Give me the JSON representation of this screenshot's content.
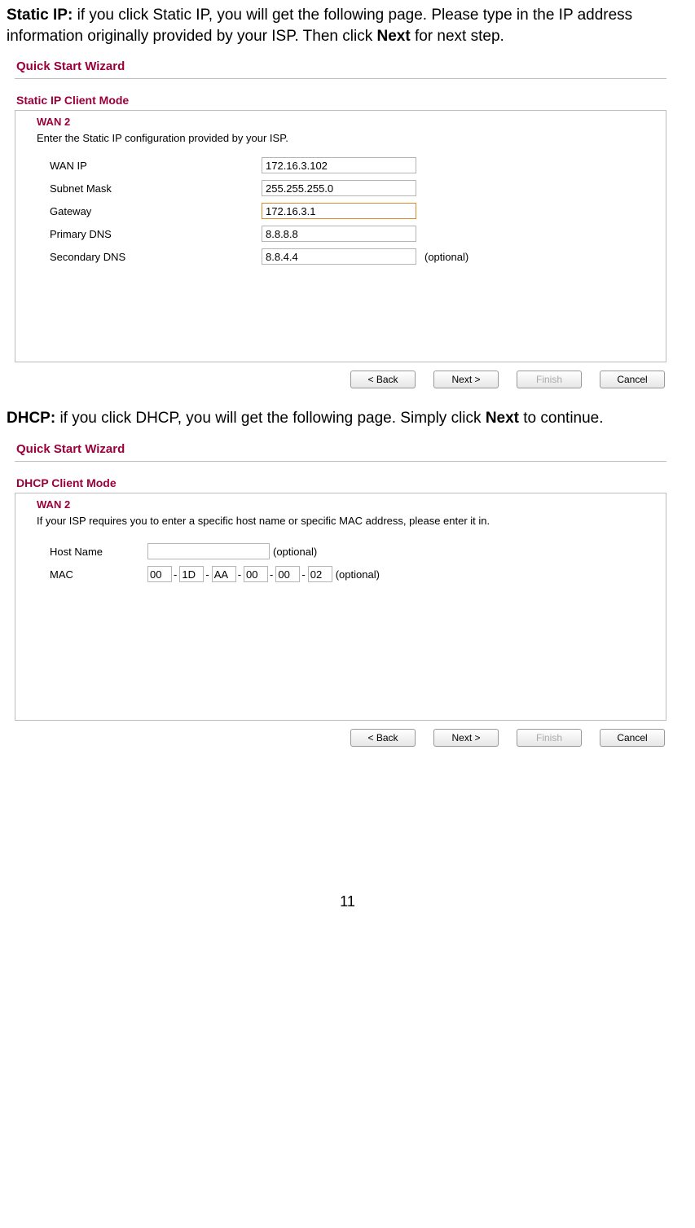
{
  "para1": {
    "lead": "Static IP:",
    "text": " if you click Static IP, you will get the following page. Please type in the IP address information originally provided by your ISP. Then click ",
    "bold_end": "Next",
    "tail": " for next step."
  },
  "para2": {
    "lead": "DHCP:",
    "text": " if you click DHCP, you will get the following page. Simply click ",
    "bold_end": "Next",
    "tail": " to continue."
  },
  "wizard": {
    "title": "Quick Start Wizard",
    "static_mode": "Static IP Client Mode",
    "dhcp_mode": "DHCP Client Mode",
    "wan_heading": "WAN 2",
    "static_desc": "Enter the Static IP configuration provided by your ISP.",
    "dhcp_desc": "If your ISP requires you to enter a specific host name or specific MAC address, please enter it in.",
    "labels": {
      "wan_ip": "WAN IP",
      "subnet": "Subnet Mask",
      "gateway": "Gateway",
      "pdns": "Primary DNS",
      "sdns": "Secondary DNS",
      "hostname": "Host Name",
      "mac": "MAC"
    },
    "values": {
      "wan_ip": "172.16.3.102",
      "subnet": "255.255.255.0",
      "gateway": "172.16.3.1",
      "pdns": "8.8.8.8",
      "sdns": "8.8.4.4",
      "hostname": "",
      "mac": [
        "00",
        "1D",
        "AA",
        "00",
        "00",
        "02"
      ]
    },
    "optional": "(optional)",
    "buttons": {
      "back": "< Back",
      "next": "Next >",
      "finish": "Finish",
      "cancel": "Cancel"
    }
  },
  "page_number": "11"
}
